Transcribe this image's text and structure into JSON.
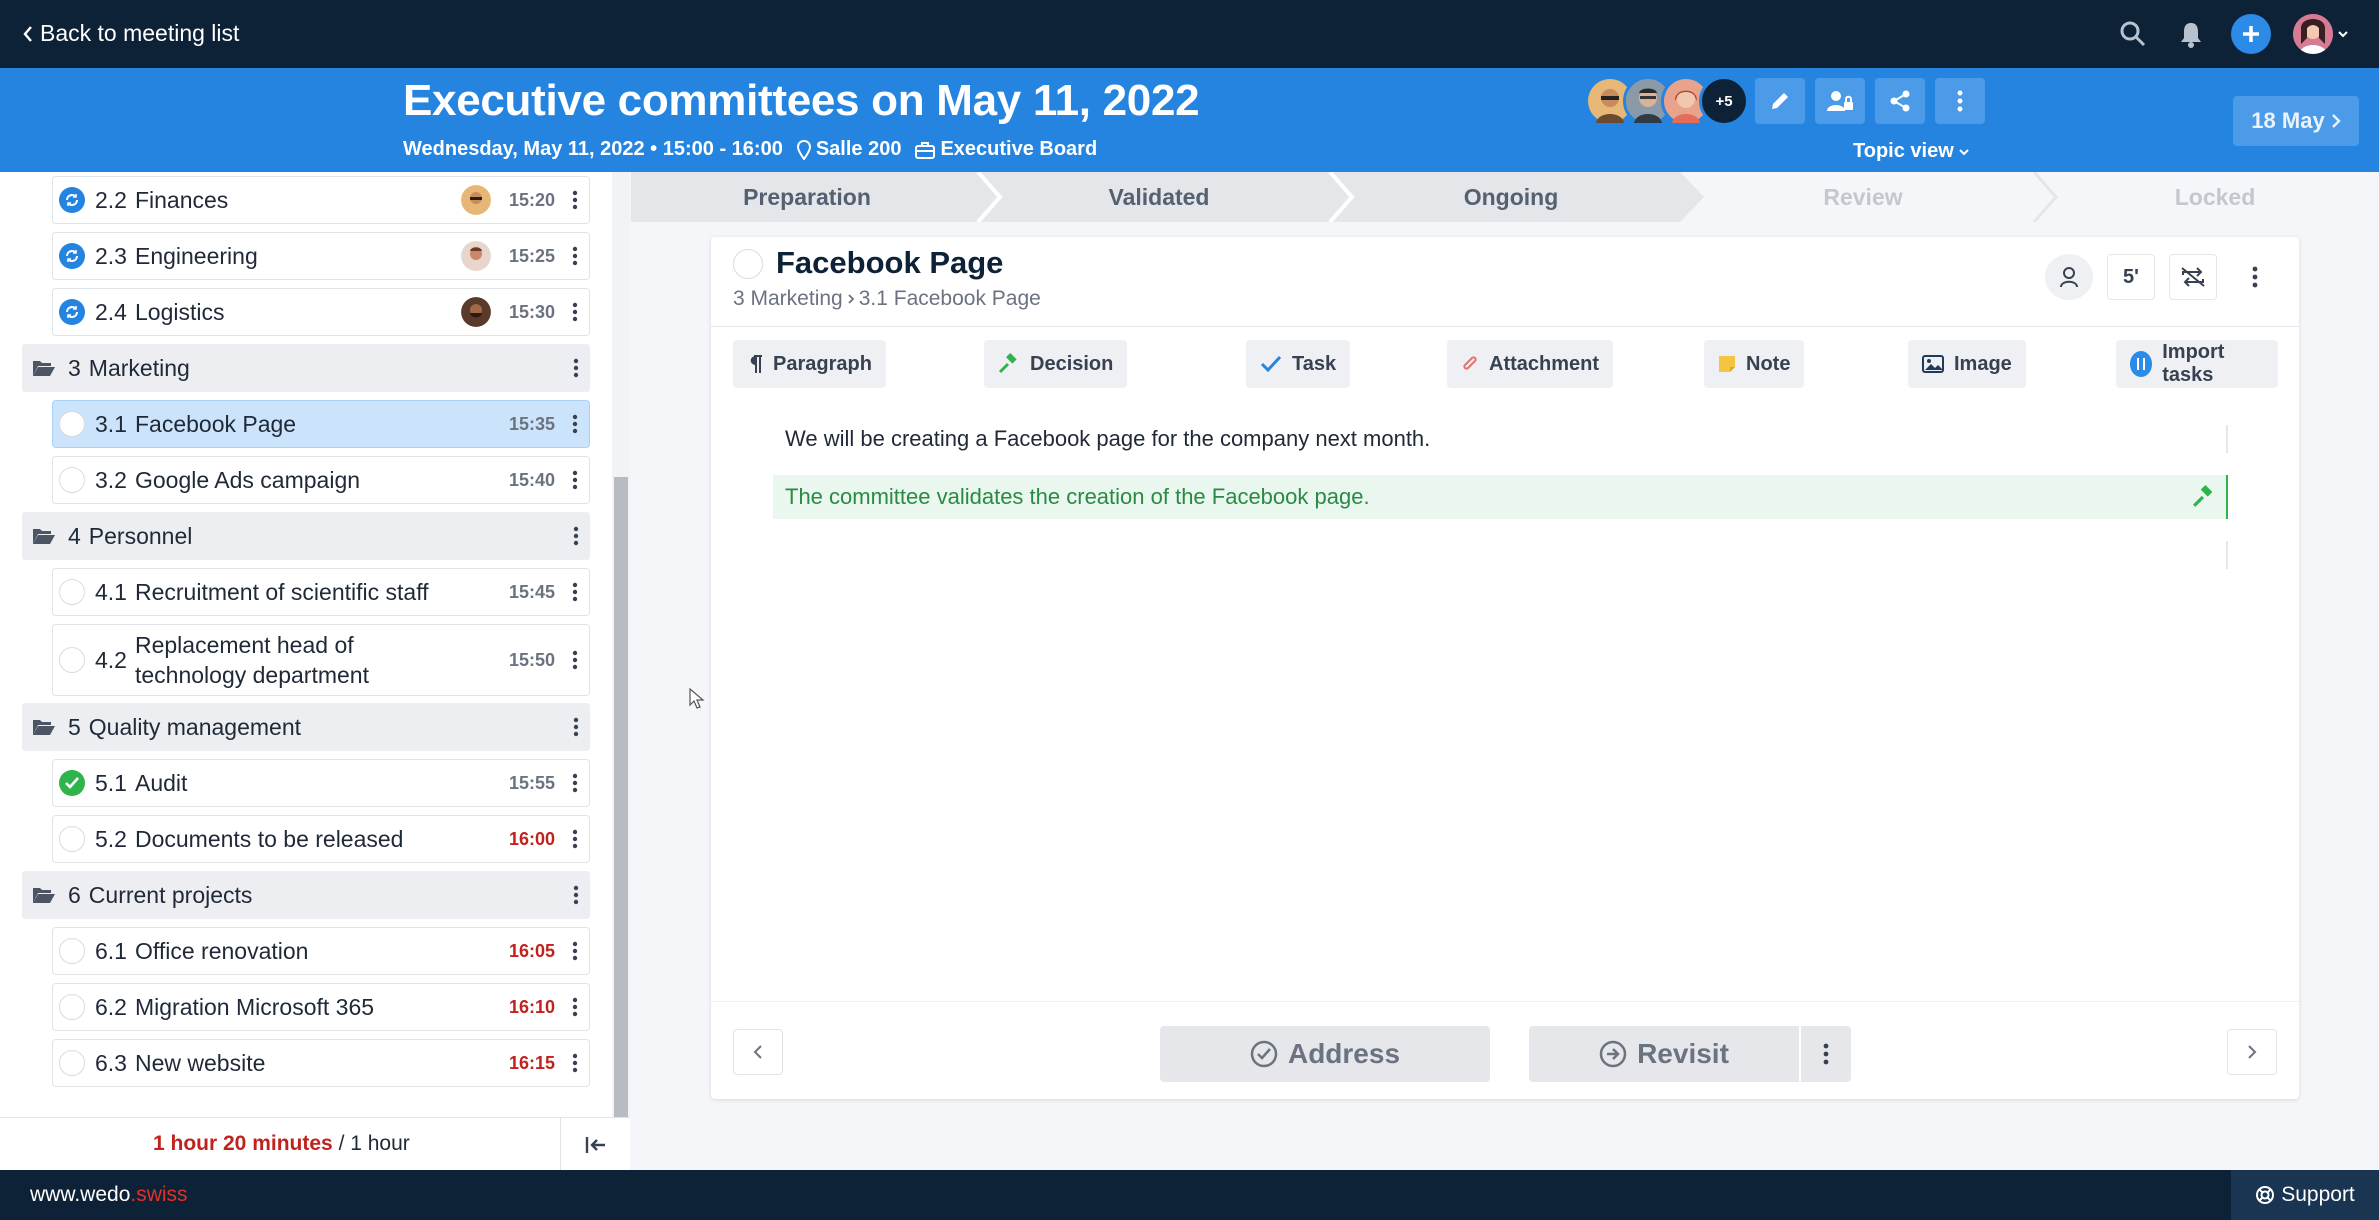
{
  "topbar": {
    "back_label": "Back to meeting list"
  },
  "header": {
    "title": "Executive committees on May 11, 2022",
    "datetime": "Wednesday, May 11, 2022 • 15:00 - 16:00",
    "location": "Salle 200",
    "board": "Executive Board",
    "participants_more": "+5",
    "topic_view_label": "Topic view",
    "next_meeting_label": "18 May"
  },
  "sidebar": {
    "topics": [
      {
        "num": "2.2",
        "label": "Finances",
        "time": "15:20",
        "status": "sync",
        "late": false
      },
      {
        "num": "2.3",
        "label": "Engineering",
        "time": "15:25",
        "status": "sync",
        "late": false
      },
      {
        "num": "2.4",
        "label": "Logistics",
        "time": "15:30",
        "status": "sync",
        "late": false
      },
      {
        "num": "3",
        "label": "Marketing",
        "section": true
      },
      {
        "num": "3.1",
        "label": "Facebook Page",
        "time": "15:35",
        "status": "empty",
        "selected": true
      },
      {
        "num": "3.2",
        "label": "Google Ads campaign",
        "time": "15:40",
        "status": "empty"
      },
      {
        "num": "4",
        "label": "Personnel",
        "section": true
      },
      {
        "num": "4.1",
        "label": "Recruitment of scientific staff",
        "time": "15:45",
        "status": "empty"
      },
      {
        "num": "4.2",
        "label_line1": "Replacement head of",
        "label_line2": "technology department",
        "time": "15:50",
        "status": "empty"
      },
      {
        "num": "5",
        "label": "Quality management",
        "section": true
      },
      {
        "num": "5.1",
        "label": "Audit",
        "time": "15:55",
        "status": "done"
      },
      {
        "num": "5.2",
        "label": "Documents to be released",
        "time": "16:00",
        "status": "empty",
        "late": true
      },
      {
        "num": "6",
        "label": "Current projects",
        "section": true
      },
      {
        "num": "6.1",
        "label": "Office renovation",
        "time": "16:05",
        "status": "empty",
        "late": true
      },
      {
        "num": "6.2",
        "label": "Migration Microsoft 365",
        "time": "16:10",
        "status": "empty",
        "late": true
      },
      {
        "num": "6.3",
        "label": "New website",
        "time": "16:15",
        "status": "empty",
        "late": true
      }
    ],
    "duration_actual": "1 hour 20 minutes",
    "duration_planned": "/ 1 hour"
  },
  "steps": [
    "Preparation",
    "Validated",
    "Ongoing",
    "Review",
    "Locked"
  ],
  "topic": {
    "title": "Facebook Page",
    "breadcrumb_section": "3 Marketing",
    "breadcrumb_topic": "3.1 Facebook Page",
    "duration": "5'"
  },
  "insert_bar": {
    "paragraph": "Paragraph",
    "decision": "Decision",
    "task": "Task",
    "attachment": "Attachment",
    "note": "Note",
    "image": "Image",
    "import_tasks": "Import tasks"
  },
  "blocks": [
    {
      "type": "paragraph",
      "text": "We will be creating a Facebook page for the company next month."
    },
    {
      "type": "decision",
      "text": "The committee validates the creation of the Facebook page."
    }
  ],
  "footer_actions": {
    "address": "Address",
    "revisit": "Revisit"
  },
  "page_footer": {
    "site_prefix": "www.wedo",
    "site_suffix": ".swiss",
    "support": "Support"
  },
  "colors": {
    "topbar": "#0d2137",
    "header": "#2584e0",
    "late": "#c0231d",
    "decision": "#2a8a45",
    "done": "#2eb44a"
  }
}
